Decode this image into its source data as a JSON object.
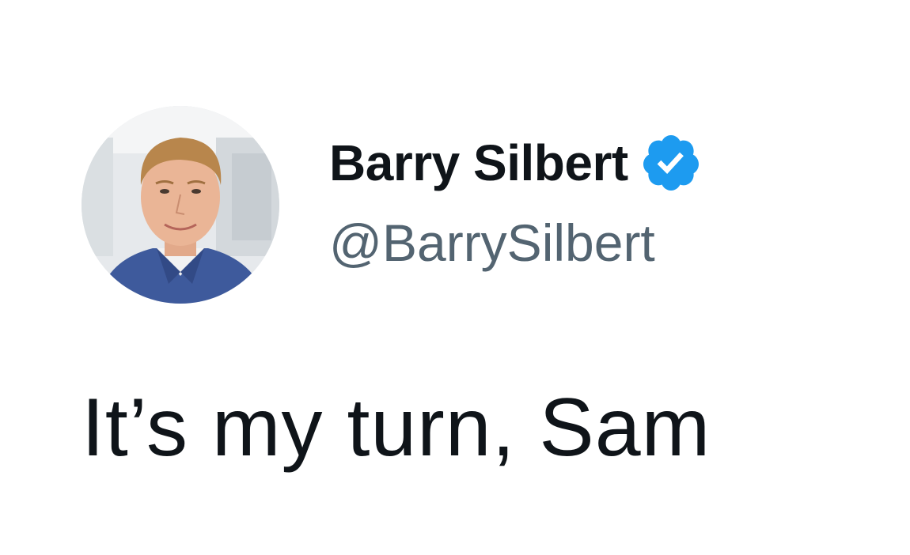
{
  "author": {
    "display_name": "Barry Silbert",
    "handle": "@BarrySilbert",
    "verified": true,
    "avatar_icon": "profile-photo"
  },
  "tweet": {
    "text": "It’s my turn, Sam"
  },
  "colors": {
    "background": "#ffffff",
    "primary_text": "#0f1419",
    "secondary_text": "#536471",
    "verified_blue": "#1d9bf0"
  }
}
